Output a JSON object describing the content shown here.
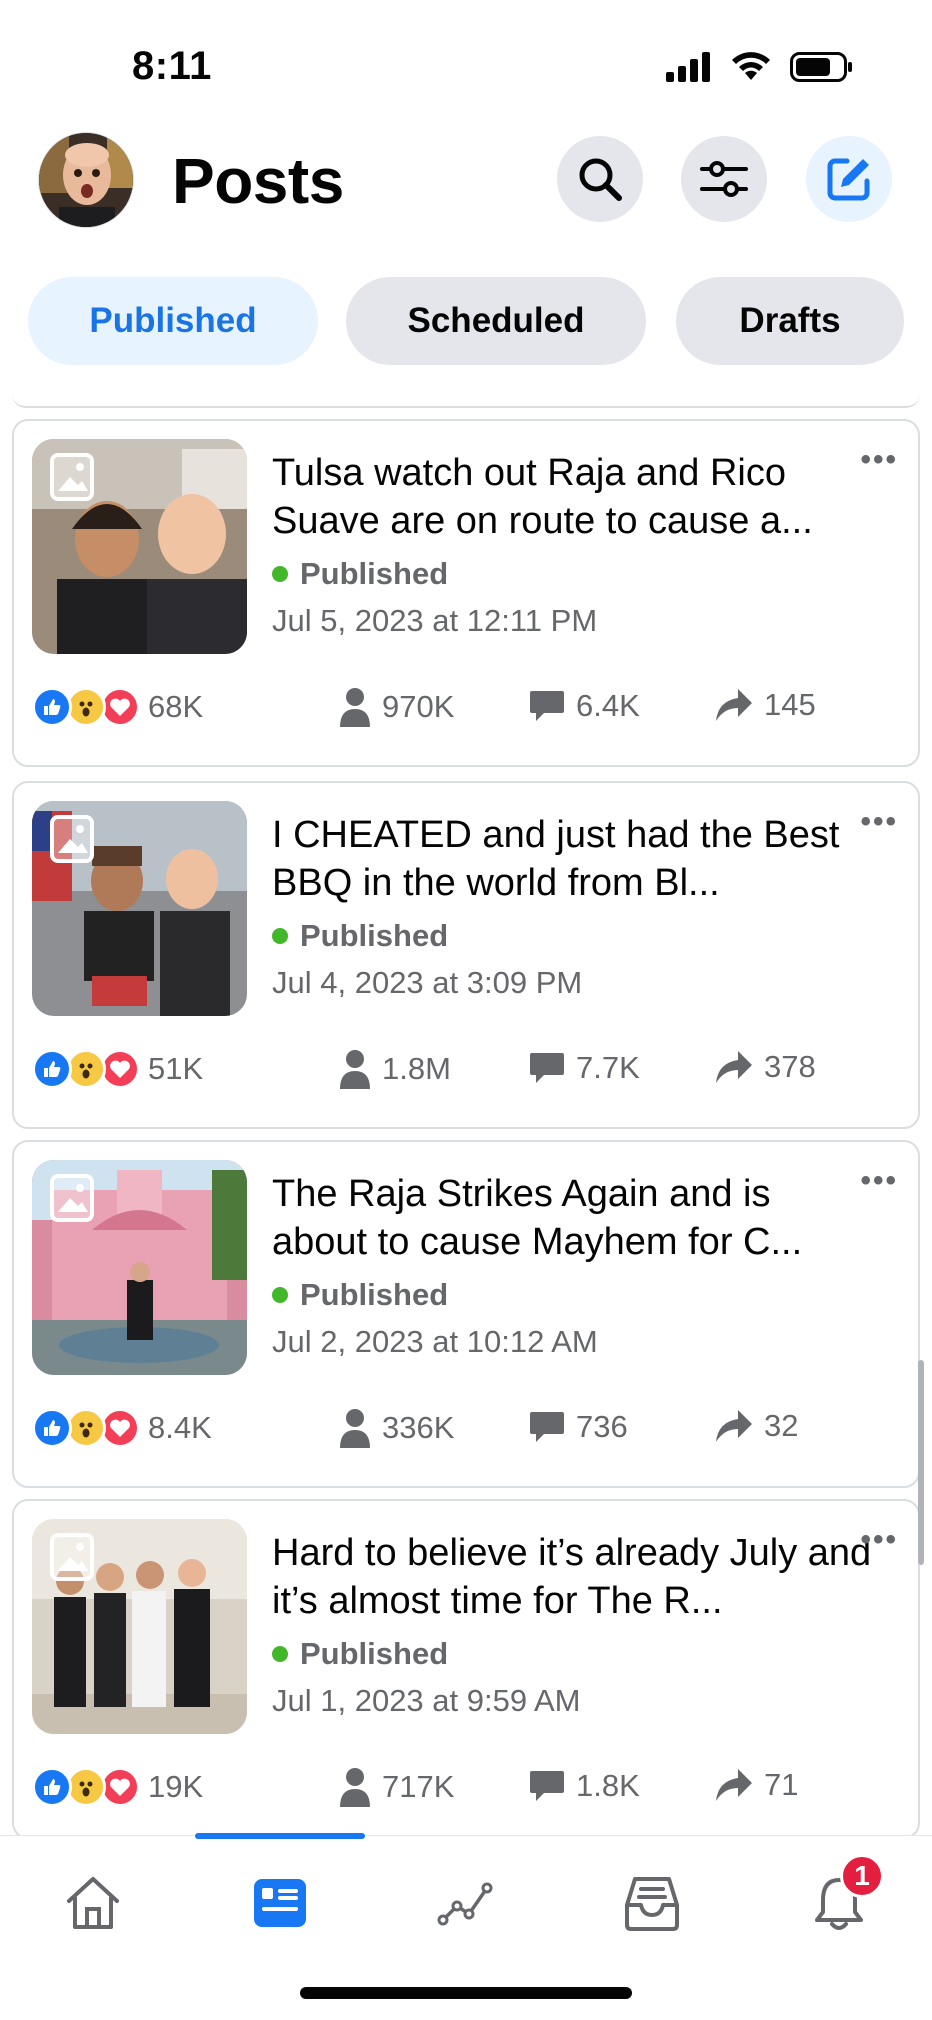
{
  "status_bar": {
    "time": "8:11"
  },
  "header": {
    "title": "Posts",
    "icons": [
      "search-icon",
      "filter-icon",
      "compose-icon"
    ]
  },
  "tabs": [
    {
      "label": "Published",
      "active": true
    },
    {
      "label": "Scheduled",
      "active": false
    },
    {
      "label": "Drafts",
      "active": false
    }
  ],
  "posts": [
    {
      "text": "Tulsa watch out Raja and Rico Suave are on route to cause a...",
      "status": "Published",
      "date": "Jul 5, 2023 at 12:11 PM",
      "reactions": "68K",
      "reach": "970K",
      "comments": "6.4K",
      "shares": "145"
    },
    {
      "text": "I CHEATED and just had the Best BBQ in the world from Bl...",
      "status": "Published",
      "date": "Jul 4, 2023 at 3:09 PM",
      "reactions": "51K",
      "reach": "1.8M",
      "comments": "7.7K",
      "shares": "378"
    },
    {
      "text": "The Raja Strikes Again and is about to cause Mayhem for C...",
      "status": "Published",
      "date": "Jul 2, 2023 at 10:12 AM",
      "reactions": "8.4K",
      "reach": "336K",
      "comments": "736",
      "shares": "32"
    },
    {
      "text": "Hard to believe it’s already July and it’s almost time for The R...",
      "status": "Published",
      "date": "Jul 1, 2023 at 9:59 AM",
      "reactions": "19K",
      "reach": "717K",
      "comments": "1.8K",
      "shares": "71"
    }
  ],
  "bottom_nav": {
    "items": [
      "home-icon",
      "posts-icon",
      "insights-icon",
      "inbox-icon",
      "notifications-icon"
    ],
    "active": "posts-icon",
    "notification_count": "1"
  },
  "colors": {
    "accent": "#1877f2",
    "active_tab_bg": "#e7f3ff",
    "published_dot": "#42b72a",
    "badge": "#e41e3f"
  }
}
